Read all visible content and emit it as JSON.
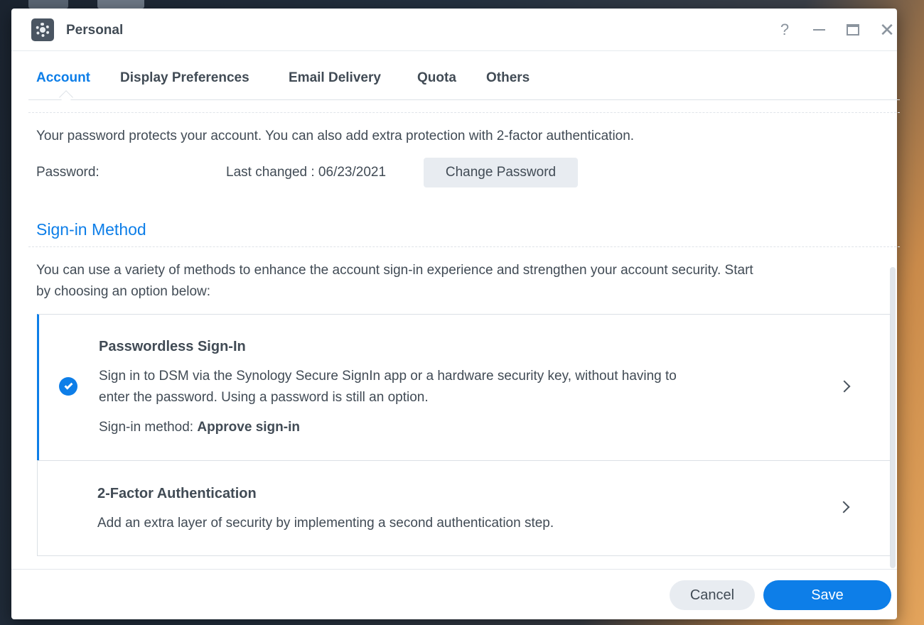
{
  "window": {
    "title": "Personal",
    "controls": {
      "help": "?",
      "close": "✕"
    }
  },
  "tabs": [
    {
      "label": "Account",
      "active": true
    },
    {
      "label": "Display Preferences",
      "active": false
    },
    {
      "label": "Email Delivery",
      "active": false
    },
    {
      "label": "Quota",
      "active": false
    },
    {
      "label": "Others",
      "active": false
    }
  ],
  "account": {
    "intro": "Your password protects your account. You can also add extra protection with 2-factor authentication.",
    "password_label": "Password:",
    "last_changed": "Last changed : 06/23/2021",
    "change_password_label": "Change Password"
  },
  "signin": {
    "section_title": "Sign-in Method",
    "intro_line1": "You can use a variety of methods to enhance the account sign-in experience and strengthen your account security. Start",
    "intro_line2": "by choosing an option below:",
    "methods": [
      {
        "title": "Passwordless Sign-In",
        "desc_line1": "Sign in to DSM via the Synology Secure SignIn app or a hardware security key, without having to",
        "desc_line2": "enter the password. Using a password is still an option.",
        "meta_label": "Sign-in method: ",
        "meta_value": "Approve sign-in",
        "selected": true
      },
      {
        "title": "2-Factor Authentication",
        "desc_line1": "Add an extra layer of security by implementing a second authentication step.",
        "selected": false
      }
    ]
  },
  "footer": {
    "cancel_label": "Cancel",
    "save_label": "Save"
  },
  "colors": {
    "accent": "#0d7ee8",
    "text": "#414b55",
    "button_secondary": "#e8ecf1"
  }
}
